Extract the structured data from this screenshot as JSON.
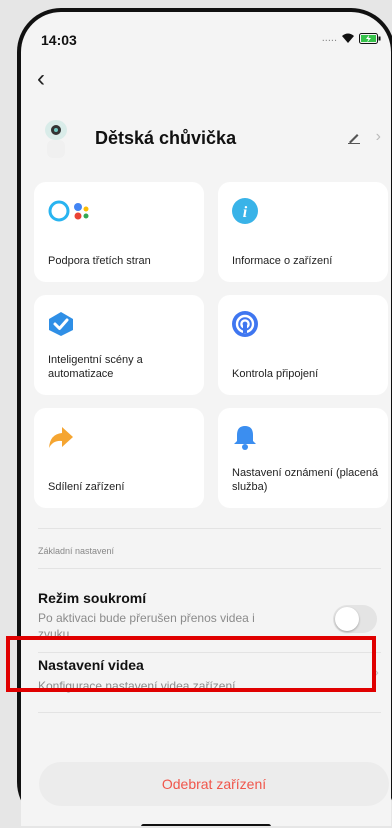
{
  "status": {
    "time": "14:03"
  },
  "header": {
    "device_name": "Dětská chůvička"
  },
  "tiles": [
    {
      "label": "Podpora třetích stran",
      "icon": "alexa-google-icon"
    },
    {
      "label": "Informace o zařízení",
      "icon": "info-icon"
    },
    {
      "label": "Inteligentní scény a automatizace",
      "icon": "smart-scene-icon"
    },
    {
      "label": "Kontrola připojení",
      "icon": "connection-check-icon"
    },
    {
      "label": "Sdílení zařízení",
      "icon": "share-icon"
    },
    {
      "label": "Nastavení oznámení (placená služba)",
      "icon": "bell-icon"
    }
  ],
  "section": {
    "label": "Základní nastavení"
  },
  "privacy": {
    "title": "Režim soukromí",
    "subtitle": "Po aktivaci bude přerušen přenos videa i zvuku",
    "enabled": false
  },
  "video": {
    "title": "Nastavení videa",
    "subtitle": "Konfigurace nastavení videa zařízení"
  },
  "remove_button": "Odebrat zařízení",
  "colors": {
    "accent_red": "#f0564b",
    "highlight": "#e00000",
    "info_blue": "#39b3e8",
    "bell_blue": "#3b8ef0",
    "share_orange": "#f5a531"
  }
}
